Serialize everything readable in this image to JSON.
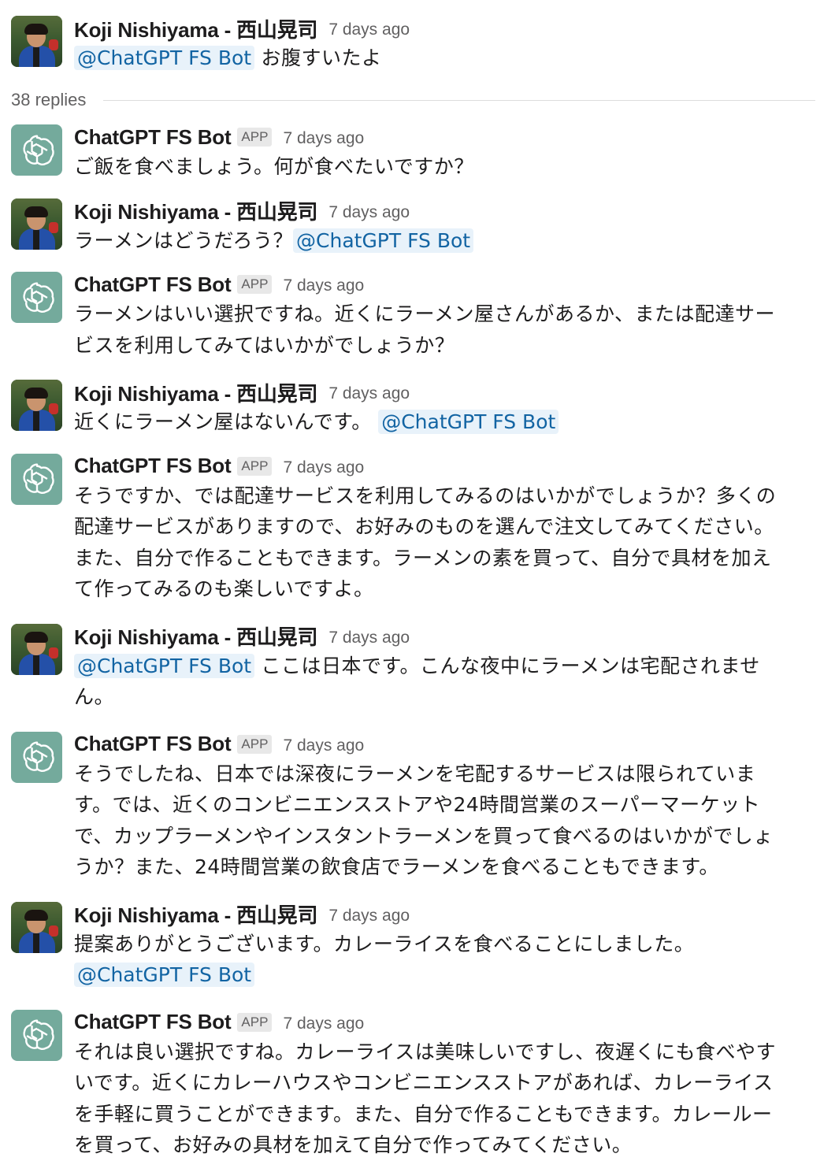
{
  "thread": {
    "root": {
      "sender": "Koji Nishiyama - 西山晃司",
      "timestamp": "7 days ago",
      "segments": [
        {
          "type": "mention",
          "text": "@ChatGPT FS Bot"
        },
        {
          "type": "text",
          "text": " お腹すいたよ"
        }
      ]
    },
    "replies_label": "38 replies",
    "badge_label": "APP",
    "messages": [
      {
        "author": "bot",
        "sender": "ChatGPT FS Bot",
        "timestamp": "7 days ago",
        "lines": [
          [
            {
              "type": "text",
              "text": "ご飯を食べましょう。何が食べたいですか？"
            }
          ]
        ]
      },
      {
        "author": "user",
        "sender": "Koji Nishiyama - 西山晃司",
        "timestamp": "7 days ago",
        "lines": [
          [
            {
              "type": "text",
              "text": "ラーメンはどうだろう？"
            },
            {
              "type": "mention",
              "text": "@ChatGPT FS Bot"
            }
          ]
        ]
      },
      {
        "author": "bot",
        "sender": "ChatGPT FS Bot",
        "timestamp": "7 days ago",
        "lines": [
          [
            {
              "type": "text",
              "text": "ラーメンはいい選択ですね。近くにラーメン屋さんがあるか、または配達サー"
            }
          ],
          [
            {
              "type": "text",
              "text": "ビスを利用してみてはいかがでしょうか？"
            }
          ]
        ]
      },
      {
        "author": "user",
        "sender": "Koji Nishiyama - 西山晃司",
        "timestamp": "7 days ago",
        "lines": [
          [
            {
              "type": "text",
              "text": "近くにラーメン屋はないんです。 "
            },
            {
              "type": "mention",
              "text": "@ChatGPT FS Bot"
            }
          ]
        ]
      },
      {
        "author": "bot",
        "sender": "ChatGPT FS Bot",
        "timestamp": "7 days ago",
        "lines": [
          [
            {
              "type": "text",
              "text": "そうですか、では配達サービスを利用してみるのはいかがでしょうか？多くの"
            }
          ],
          [
            {
              "type": "text",
              "text": "配達サービスがありますので、お好みのものを選んで注文してみてください。"
            }
          ],
          [
            {
              "type": "text",
              "text": "また、自分で作ることもできます。ラーメンの素を買って、自分で具材を加え"
            }
          ],
          [
            {
              "type": "text",
              "text": "て作ってみるのも楽しいですよ。"
            }
          ]
        ]
      },
      {
        "author": "user",
        "sender": "Koji Nishiyama - 西山晃司",
        "timestamp": "7 days ago",
        "lines": [
          [
            {
              "type": "mention",
              "text": "@ChatGPT FS Bot"
            },
            {
              "type": "text",
              "text": " ここは日本です。こんな夜中にラーメンは宅配されませ"
            }
          ],
          [
            {
              "type": "text",
              "text": "ん。"
            }
          ]
        ]
      },
      {
        "author": "bot",
        "sender": "ChatGPT FS Bot",
        "timestamp": "7 days ago",
        "lines": [
          [
            {
              "type": "text",
              "text": "そうでしたね、日本では深夜にラーメンを宅配するサービスは限られていま"
            }
          ],
          [
            {
              "type": "text",
              "text": "す。では、近くのコンビニエンスストアや24時間営業のスーパーマーケット"
            }
          ],
          [
            {
              "type": "text",
              "text": "で、カップラーメンやインスタントラーメンを買って食べるのはいかがでしょ"
            }
          ],
          [
            {
              "type": "text",
              "text": "うか？また、24時間営業の飲食店でラーメンを食べることもできます。"
            }
          ]
        ]
      },
      {
        "author": "user",
        "sender": "Koji Nishiyama - 西山晃司",
        "timestamp": "7 days ago",
        "lines": [
          [
            {
              "type": "text",
              "text": "提案ありがとうございます。カレーライスを食べることにしました。"
            }
          ],
          [
            {
              "type": "mention",
              "text": "@ChatGPT FS Bot"
            }
          ]
        ]
      },
      {
        "author": "bot",
        "sender": "ChatGPT FS Bot",
        "timestamp": "7 days ago",
        "lines": [
          [
            {
              "type": "text",
              "text": "それは良い選択ですね。カレーライスは美味しいですし、夜遅くにも食べやす"
            }
          ],
          [
            {
              "type": "text",
              "text": "いです。近くにカレーハウスやコンビニエンスストアがあれば、カレーライス"
            }
          ],
          [
            {
              "type": "text",
              "text": "を手軽に買うことができます。また、自分で作ることもできます。カレールー"
            }
          ],
          [
            {
              "type": "text",
              "text": "を買って、お好みの具材を加えて自分で作ってみてください。"
            }
          ]
        ]
      }
    ]
  },
  "icons": {
    "bot_avatar": "openai-logo-icon",
    "user_avatar": "user-photo-avatar"
  },
  "colors": {
    "mention_bg": "#e8f2fa",
    "mention_text": "#1264a3",
    "bot_avatar_bg": "#74aa9c",
    "meta_text": "#616061"
  }
}
